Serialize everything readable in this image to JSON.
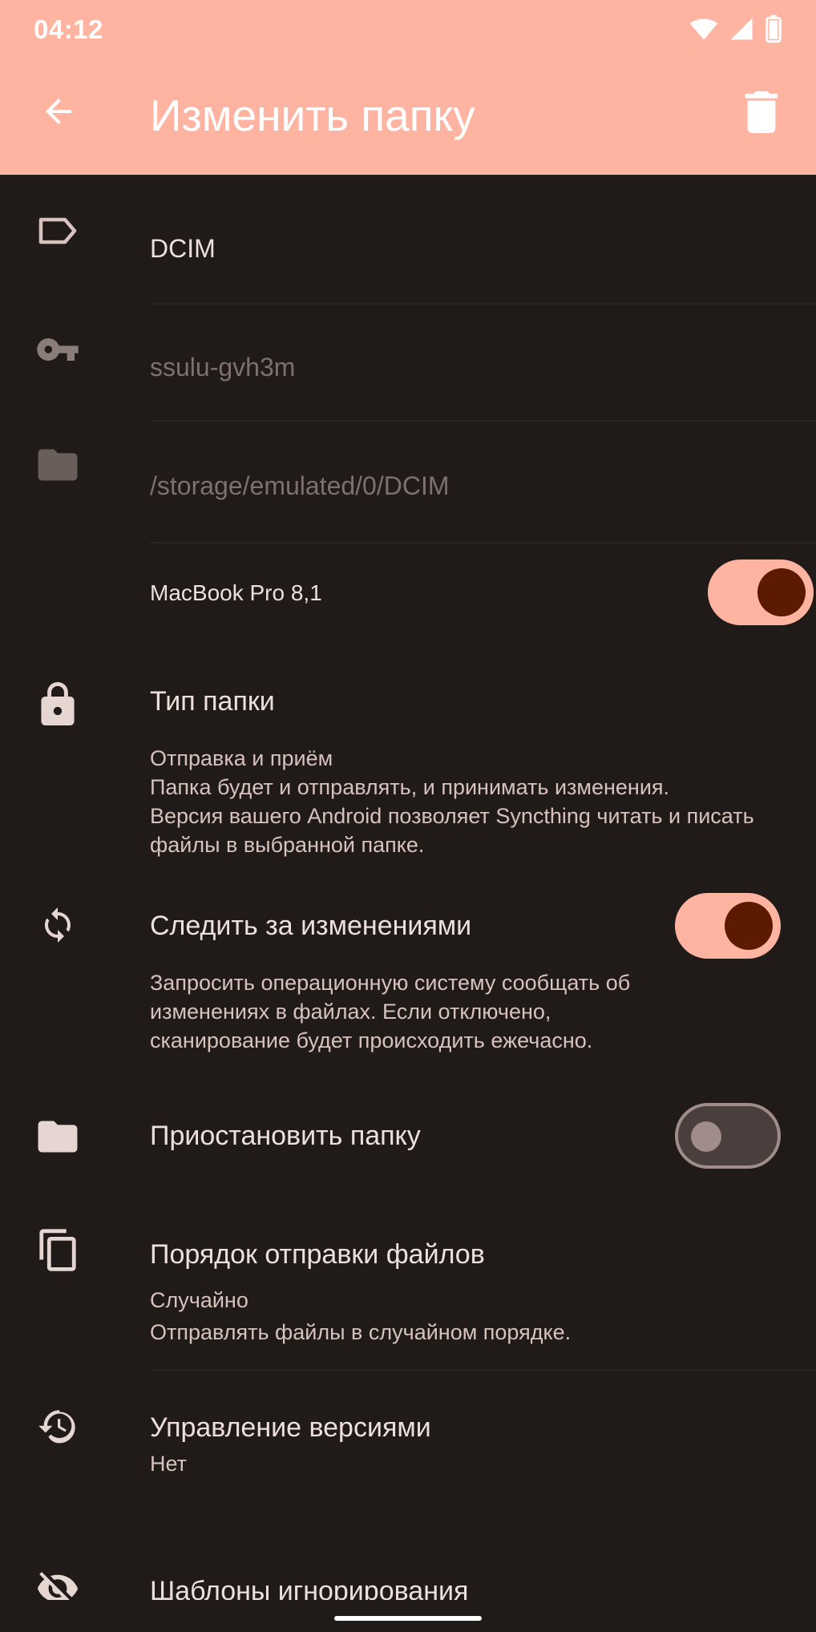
{
  "status_bar": {
    "time": "04:12"
  },
  "toolbar": {
    "title": "Изменить папку",
    "back_icon": "arrow-back-icon",
    "delete_icon": "delete-icon"
  },
  "folder": {
    "label": "DCIM",
    "id": "ssulu-gvh3m",
    "path": "/storage/emulated/0/DCIM"
  },
  "device_share": {
    "name": "MacBook Pro 8,1",
    "enabled": true
  },
  "folder_type": {
    "title": "Тип папки",
    "summary": "Отправка и приём\nПапка будет и отправлять, и принимать изменения.\nВерсия вашего Android позволяет Syncthing читать и писать файлы в выбранной папке."
  },
  "watch_changes": {
    "title": "Следить за изменениями",
    "summary": "Запросить операционную систему сообщать об изменениях в файлах. Если отключено, сканирование будет происходить ежечасно.",
    "enabled": true
  },
  "pause_folder": {
    "title": "Приостановить папку",
    "enabled": false
  },
  "pull_order": {
    "title": "Порядок отправки файлов",
    "summary": "Случайно\nОтправлять файлы в случайном порядке."
  },
  "versioning": {
    "title": "Управление версиями",
    "summary": "Нет"
  },
  "ignore_patterns": {
    "title": "Шаблоны игнорирования"
  },
  "colors": {
    "app_bar": "#ffb4a1",
    "background": "#201a19",
    "switch_on_track": "#ffb4a1",
    "switch_on_thumb": "#5c1a00"
  }
}
